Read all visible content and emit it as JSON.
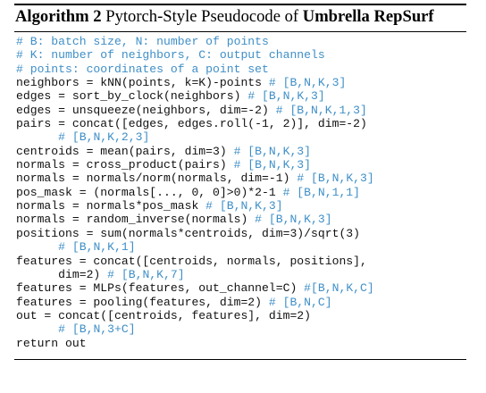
{
  "caption": {
    "label": "Algorithm 2",
    "text": "Pytorch-Style Pseudocode of",
    "method": "Umbrella RepSurf"
  },
  "colors": {
    "code": "#111111",
    "comment": "#3f8fc7",
    "rule": "#000000"
  },
  "code_lines": [
    {
      "code": "",
      "comment": "# B: batch size, N: number of points"
    },
    {
      "code": "",
      "comment": "# K: number of neighbors, C: output channels"
    },
    {
      "code": "",
      "comment": "# points: coordinates of a point set"
    },
    {
      "code": "neighbors = kNN(points, k=K)-points ",
      "comment": "# [B,N,K,3]"
    },
    {
      "code": "edges = sort_by_clock(neighbors) ",
      "comment": "# [B,N,K,3]"
    },
    {
      "code": "edges = unsqueeze(neighbors, dim=-2) ",
      "comment": "# [B,N,K,1,3]"
    },
    {
      "code": "pairs = concat([edges, edges.roll(-1, 2)], dim=-2)",
      "comment": ""
    },
    {
      "code": "      ",
      "comment": "# [B,N,K,2,3]"
    },
    {
      "code": "centroids = mean(pairs, dim=3) ",
      "comment": "# [B,N,K,3]"
    },
    {
      "code": "normals = cross_product(pairs) ",
      "comment": "# [B,N,K,3]"
    },
    {
      "code": "normals = normals/norm(normals, dim=-1) ",
      "comment": "# [B,N,K,3]"
    },
    {
      "code": "pos_mask = (normals[..., 0, 0]>0)*2-1 ",
      "comment": "# [B,N,1,1]"
    },
    {
      "code": "normals = normals*pos_mask ",
      "comment": "# [B,N,K,3]"
    },
    {
      "code": "normals = random_inverse(normals) ",
      "comment": "# [B,N,K,3]"
    },
    {
      "code": "positions = sum(normals*centroids, dim=3)/sqrt(3)",
      "comment": ""
    },
    {
      "code": "      ",
      "comment": "# [B,N,K,1]"
    },
    {
      "code": "features = concat([centroids, normals, positions],",
      "comment": ""
    },
    {
      "code": "      dim=2) ",
      "comment": "# [B,N,K,7]"
    },
    {
      "code": "features = MLPs(features, out_channel=C) ",
      "comment": "#[B,N,K,C]"
    },
    {
      "code": "features = pooling(features, dim=2) ",
      "comment": "# [B,N,C]"
    },
    {
      "code": "out = concat([centroids, features], dim=2)",
      "comment": ""
    },
    {
      "code": "      ",
      "comment": "# [B,N,3+C]"
    },
    {
      "code": "return out",
      "comment": ""
    }
  ]
}
